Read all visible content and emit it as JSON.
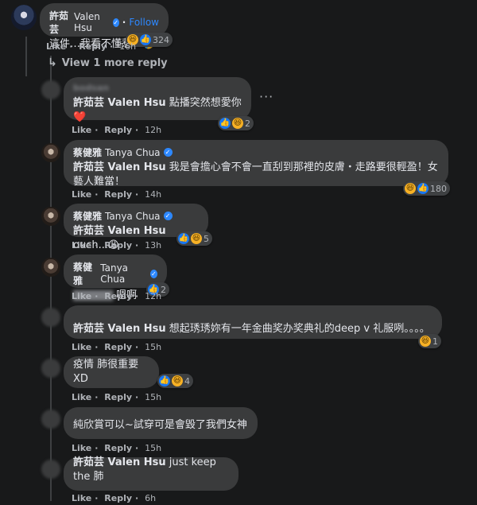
{
  "comments": [
    {
      "id": "c0",
      "name_zh": "許茹芸",
      "name_en": "Valen Hsu",
      "verified": true,
      "follow": "Follow",
      "text": "這件…我看不懂惹…🤣",
      "like": "Like",
      "reply": "Reply",
      "time": "16h",
      "reaction_count": "324",
      "reactions": [
        "haha",
        "like"
      ]
    },
    {
      "id": "c1",
      "name_blurred": "bodsan",
      "tag_zh": "許茹芸",
      "tag_en": "Valen Hsu",
      "text": "點播突然想愛你❤️",
      "like": "Like",
      "reply": "Reply",
      "time": "12h",
      "reaction_count": "2",
      "reactions": [
        "like",
        "haha"
      ]
    },
    {
      "id": "c2",
      "name_zh": "蔡健雅",
      "name_en": "Tanya Chua",
      "verified": true,
      "tag_zh": "許茹芸",
      "tag_en": "Valen Hsu",
      "text_line1": "我是會擔心會不會一直刮到那裡的皮膚・走路要很輕盈！女",
      "text_line2": "藝人難當！",
      "like": "Like",
      "reply": "Reply",
      "time": "14h",
      "reaction_count": "180",
      "reactions": [
        "haha",
        "like"
      ]
    },
    {
      "id": "c3",
      "name_zh": "蔡健雅",
      "name_en": "Tanya Chua",
      "verified": true,
      "tag_zh": "許茹芸",
      "tag_en": "Valen Hsu",
      "text": "ouch...😩",
      "like": "Like",
      "reply": "Reply",
      "time": "13h",
      "reaction_count": "5",
      "reactions": [
        "like",
        "haha"
      ]
    },
    {
      "id": "c4",
      "name_zh": "蔡健雅",
      "name_en": "Tanya Chua",
      "verified": true,
      "tag_blurred": "▇▇▇▇▇",
      "text": "嗯啊",
      "like": "Like",
      "reply": "Reply",
      "time": "12h",
      "reaction_count": "2",
      "reactions": [
        "like"
      ]
    },
    {
      "id": "c5",
      "tag_zh": "許茹芸",
      "tag_en": "Valen Hsu",
      "text": "想起琇琇妳有一年金曲奖办奖典礼的deep v 礼服咧。。。。",
      "like": "Like",
      "reply": "Reply",
      "time": "15h",
      "reaction_count": "1",
      "reactions": [
        "haha"
      ]
    },
    {
      "id": "c6",
      "text": "疫情 肺很重要XD",
      "like": "Like",
      "reply": "Reply",
      "time": "15h",
      "reaction_count": "4",
      "reactions": [
        "like",
        "haha"
      ]
    },
    {
      "id": "c7",
      "text": "純欣賞可以~試穿可是會毀了我們女神",
      "like": "Like",
      "reply": "Reply",
      "time": "15h"
    },
    {
      "id": "c8",
      "tag_zh": "許茹芸",
      "tag_en": "Valen Hsu",
      "text": "just keep the 肺",
      "like": "Like",
      "reply": "Reply",
      "time": "6h"
    }
  ],
  "view_more_replies": "View 1 more reply",
  "options_icon": "more-options-icon"
}
